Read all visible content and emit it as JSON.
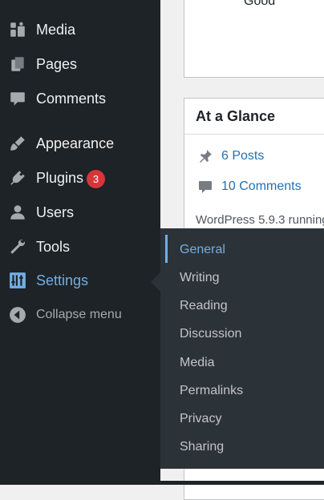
{
  "sidebar": {
    "items": [
      {
        "label": "Media",
        "icon": "media-icon"
      },
      {
        "label": "Pages",
        "icon": "pages-icon"
      },
      {
        "label": "Comments",
        "icon": "comments-icon"
      },
      {
        "label": "Appearance",
        "icon": "appearance-icon"
      },
      {
        "label": "Plugins",
        "icon": "plugins-icon",
        "badge": "3"
      },
      {
        "label": "Users",
        "icon": "users-icon"
      },
      {
        "label": "Tools",
        "icon": "tools-icon"
      },
      {
        "label": "Settings",
        "icon": "settings-icon",
        "current": true
      },
      {
        "label": "Collapse menu",
        "icon": "collapse-icon"
      }
    ]
  },
  "submenu": {
    "items": [
      {
        "label": "General",
        "current": true
      },
      {
        "label": "Writing"
      },
      {
        "label": "Reading"
      },
      {
        "label": "Discussion"
      },
      {
        "label": "Media"
      },
      {
        "label": "Permalinks"
      },
      {
        "label": "Privacy"
      },
      {
        "label": "Sharing"
      }
    ]
  },
  "content": {
    "top_card": {
      "status_text": "Good"
    },
    "glance": {
      "title": "At a Glance",
      "posts_link": "6 Posts",
      "comments_link": "10 Comments",
      "info_text": "WordPress 5.9.3 running"
    }
  },
  "colors": {
    "sidebar_bg": "#1d2327",
    "submenu_bg": "#2c3338",
    "accent": "#72aee6",
    "badge": "#d63638",
    "link": "#2271b1"
  }
}
